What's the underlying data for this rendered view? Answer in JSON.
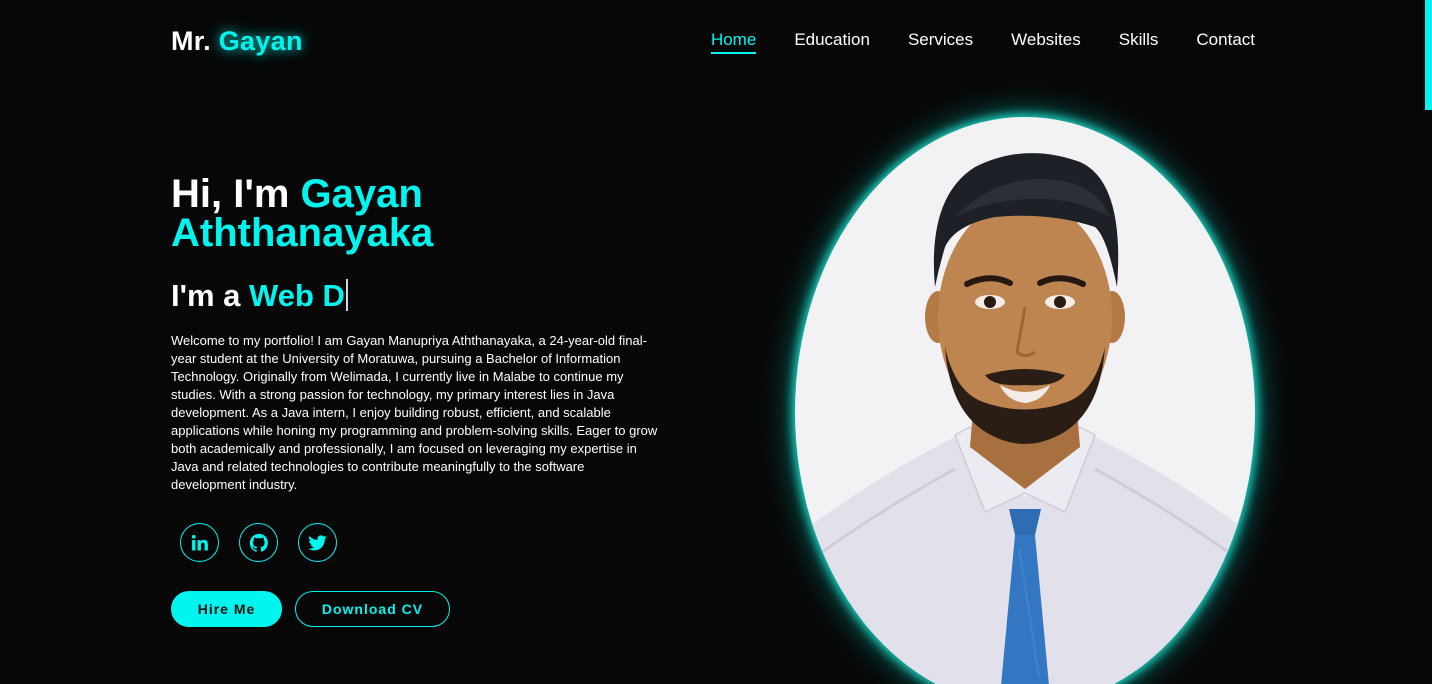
{
  "header": {
    "logo_prefix": "Mr.",
    "logo_name": "Gayan",
    "nav": [
      {
        "label": "Home",
        "active": true
      },
      {
        "label": "Education",
        "active": false
      },
      {
        "label": "Services",
        "active": false
      },
      {
        "label": "Websites",
        "active": false
      },
      {
        "label": "Skills",
        "active": false
      },
      {
        "label": "Contact",
        "active": false
      }
    ]
  },
  "hero": {
    "greeting": "Hi, I'm",
    "name": "Gayan Aththanayaka",
    "role_prefix": "I'm a",
    "role_typed": "Web D",
    "about": "Welcome to my portfolio! I am Gayan Manupriya Aththanayaka, a 24-year-old final-year student at the University of Moratuwa, pursuing a Bachelor of Information Technology. Originally from Welimada, I currently live in Malabe to continue my studies. With a strong passion for technology, my primary interest lies in Java development. As a Java intern, I enjoy building robust, efficient, and scalable applications while honing my programming and problem-solving skills. Eager to grow both academically and professionally, I am focused on leveraging my expertise in Java and related technologies to contribute meaningfully to the software development industry."
  },
  "social": [
    {
      "icon": "linkedin-icon"
    },
    {
      "icon": "github-icon"
    },
    {
      "icon": "twitter-icon"
    }
  ],
  "buttons": {
    "hire": "Hire Me",
    "download_cv": "Download CV"
  },
  "profile_image": {
    "icon": "profile-photo"
  },
  "colors": {
    "accent": "#00f5ee",
    "background": "#070708",
    "text": "#ffffff"
  }
}
